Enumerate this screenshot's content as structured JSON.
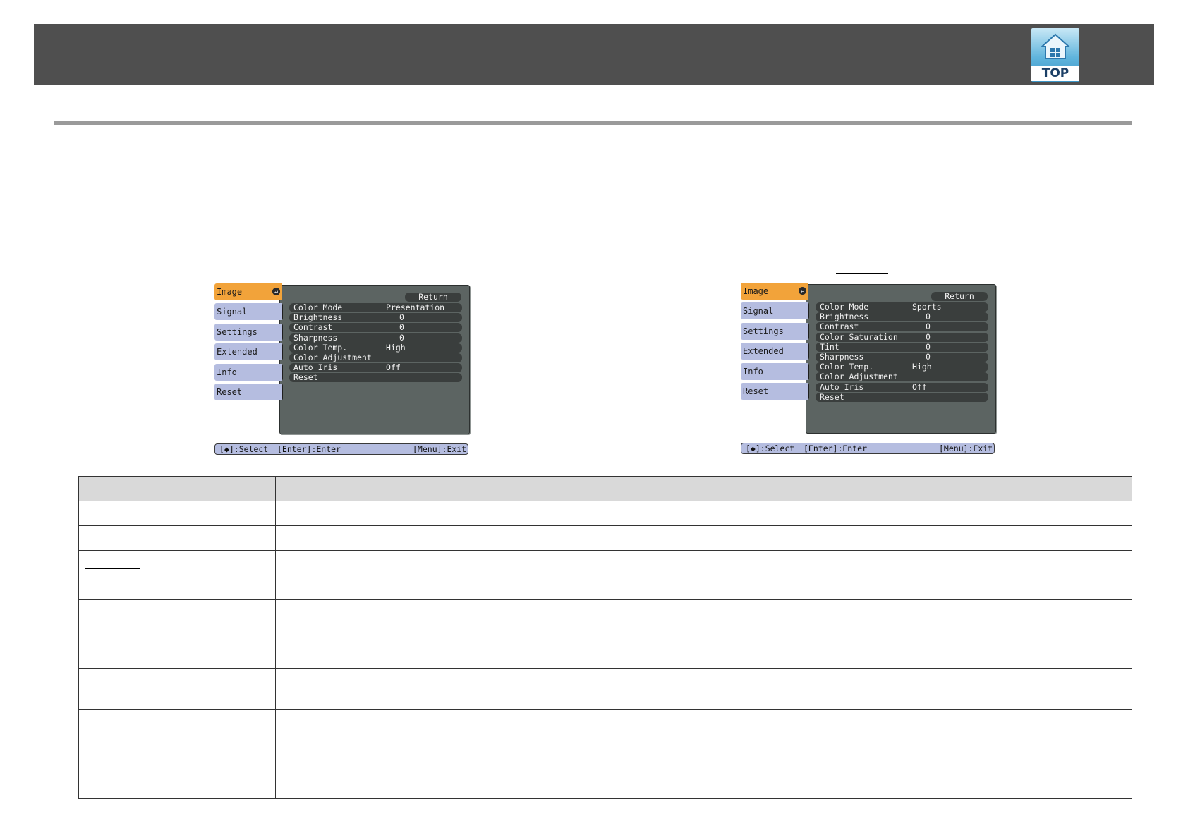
{
  "header": {
    "top_button_label": "TOP",
    "top_icon": "house-icon"
  },
  "osd_left": {
    "tabs": [
      "Image",
      "Signal",
      "Settings",
      "Extended",
      "Info",
      "Reset"
    ],
    "active_tab": "Image",
    "return_label": "Return",
    "items": [
      {
        "label": "Color Mode",
        "value": "Presentation"
      },
      {
        "label": "Brightness",
        "value": "0"
      },
      {
        "label": "Contrast",
        "value": "0"
      },
      {
        "label": "Sharpness",
        "value": "0"
      },
      {
        "label": "Color Temp.",
        "value": "High"
      },
      {
        "label": "Color Adjustment",
        "value": ""
      },
      {
        "label": "Auto Iris",
        "value": "Off"
      },
      {
        "label": "Reset",
        "value": ""
      }
    ],
    "footer": {
      "select": "[◆]:Select",
      "enter": "[Enter]:Enter",
      "exit": "[Menu]:Exit"
    }
  },
  "osd_right": {
    "tabs": [
      "Image",
      "Signal",
      "Settings",
      "Extended",
      "Info",
      "Reset"
    ],
    "active_tab": "Image",
    "return_label": "Return",
    "items": [
      {
        "label": "Color Mode",
        "value": "Sports"
      },
      {
        "label": "Brightness",
        "value": "0"
      },
      {
        "label": "Contrast",
        "value": "0"
      },
      {
        "label": "Color Saturation",
        "value": "0"
      },
      {
        "label": "Tint",
        "value": "0"
      },
      {
        "label": "Sharpness",
        "value": "0"
      },
      {
        "label": "Color Temp.",
        "value": "High"
      },
      {
        "label": "Color Adjustment",
        "value": ""
      },
      {
        "label": "Auto Iris",
        "value": "Off"
      },
      {
        "label": "Reset",
        "value": ""
      }
    ],
    "footer": {
      "select": "[◆]:Select",
      "enter": "[Enter]:Enter",
      "exit": "[Menu]:Exit"
    }
  },
  "colors": {
    "header_bg": "#4f4f4f",
    "active_tab": "#f2a33a",
    "inactive_tab": "#b5bde0",
    "panel_bg": "#5c6462",
    "table_head_bg": "#d9d9d9"
  }
}
